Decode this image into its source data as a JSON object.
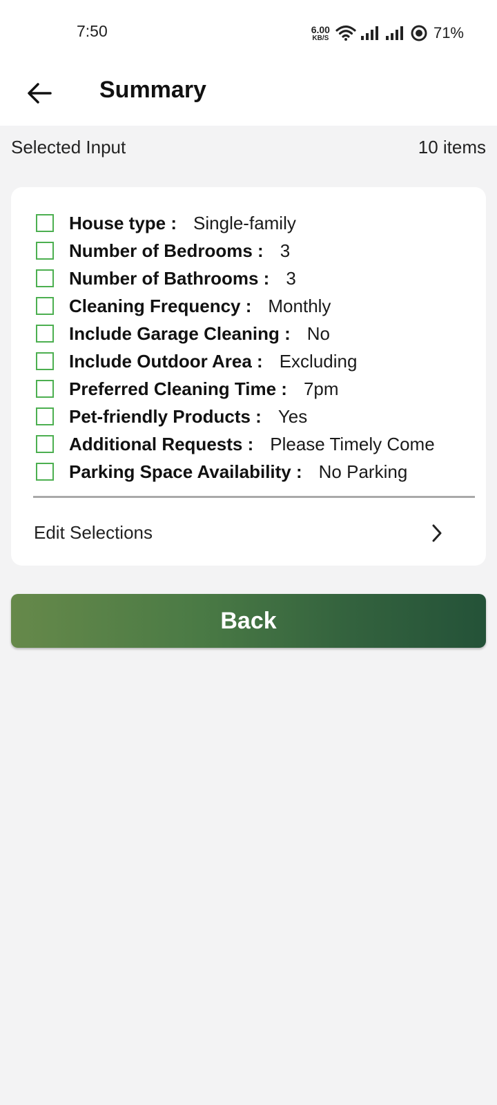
{
  "status_bar": {
    "time": "7:50",
    "net_speed_value": "6.00",
    "net_speed_unit": "KB/S",
    "battery": "71%",
    "icons": [
      "wifi-icon",
      "signal-icon",
      "signal-icon",
      "battery-icon"
    ]
  },
  "header": {
    "title": "Summary",
    "back_icon": "arrow-left-icon"
  },
  "section": {
    "label": "Selected Input",
    "count": "10 items"
  },
  "items": [
    {
      "label": "House type :",
      "value": "Single-family"
    },
    {
      "label": "Number of Bedrooms :",
      "value": "3"
    },
    {
      "label": "Number of Bathrooms :",
      "value": "3"
    },
    {
      "label": "Cleaning Frequency :",
      "value": "Monthly"
    },
    {
      "label": "Include Garage Cleaning :",
      "value": "No"
    },
    {
      "label": "Include Outdoor Area :",
      "value": "Excluding"
    },
    {
      "label": "Preferred Cleaning Time :",
      "value": "7pm"
    },
    {
      "label": "Pet-friendly Products :",
      "value": "Yes"
    },
    {
      "label": "Additional Requests :",
      "value": "Please Timely Come"
    },
    {
      "label": "Parking Space Availability :",
      "value": "No Parking"
    }
  ],
  "edit": {
    "label": "Edit Selections",
    "icon": "chevron-right-icon"
  },
  "back_button": {
    "label": "Back"
  },
  "colors": {
    "checkbox_border": "#4caf50",
    "button_gradient_start": "#66894a",
    "button_gradient_end": "#245238",
    "background": "#f3f3f4"
  }
}
